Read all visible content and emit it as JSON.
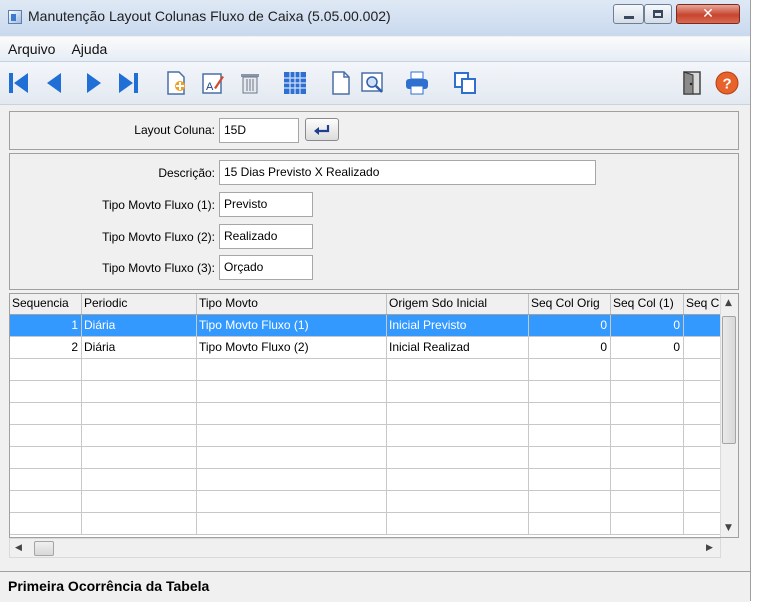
{
  "window": {
    "title": "Manutenção Layout Colunas Fluxo de Caixa (5.05.00.002)"
  },
  "menu": {
    "items": [
      {
        "label": "Arquivo"
      },
      {
        "label": "Ajuda"
      }
    ]
  },
  "toolbar": {
    "icons": [
      "first-record-icon",
      "previous-record-icon",
      "next-record-icon",
      "last-record-icon",
      "new-record-icon",
      "edit-record-icon",
      "delete-record-icon",
      "grid-view-icon",
      "blank-document-icon",
      "print-preview-icon",
      "print-icon",
      "copy-icon",
      "exit-door-icon",
      "help-icon"
    ]
  },
  "header": {
    "layout_label": "Layout Coluna:",
    "layout_value": "15D"
  },
  "details": {
    "descricao_label": "Descrição:",
    "descricao_value": "15 Dias Previsto X Realizado",
    "tipo1_label": "Tipo Movto Fluxo (1):",
    "tipo1_value": "Previsto",
    "tipo2_label": "Tipo Movto Fluxo (2):",
    "tipo2_value": "Realizado",
    "tipo3_label": "Tipo Movto Fluxo (3):",
    "tipo3_value": "Orçado"
  },
  "grid": {
    "columns": [
      "Sequencia",
      "Periodic",
      "Tipo Movto",
      "Origem Sdo Inicial",
      "Seq Col Orig",
      "Seq Col (1)",
      "Seq C"
    ],
    "rows": [
      {
        "seq": "1",
        "periodic": "Diária",
        "tipo": "Tipo Movto Fluxo (1)",
        "origem": "Inicial Previsto",
        "seq_orig": "0",
        "seq_col1": "0",
        "seq_c": "",
        "selected": true
      },
      {
        "seq": "2",
        "periodic": "Diária",
        "tipo": "Tipo Movto Fluxo (2)",
        "origem": "Inicial Realizad",
        "seq_orig": "0",
        "seq_col1": "0",
        "seq_c": "",
        "selected": false
      }
    ]
  },
  "status": {
    "text": "Primeira Ocorrência da Tabela"
  },
  "colors": {
    "selection": "#3399ff",
    "nav_blue": "#1f6fd6"
  }
}
